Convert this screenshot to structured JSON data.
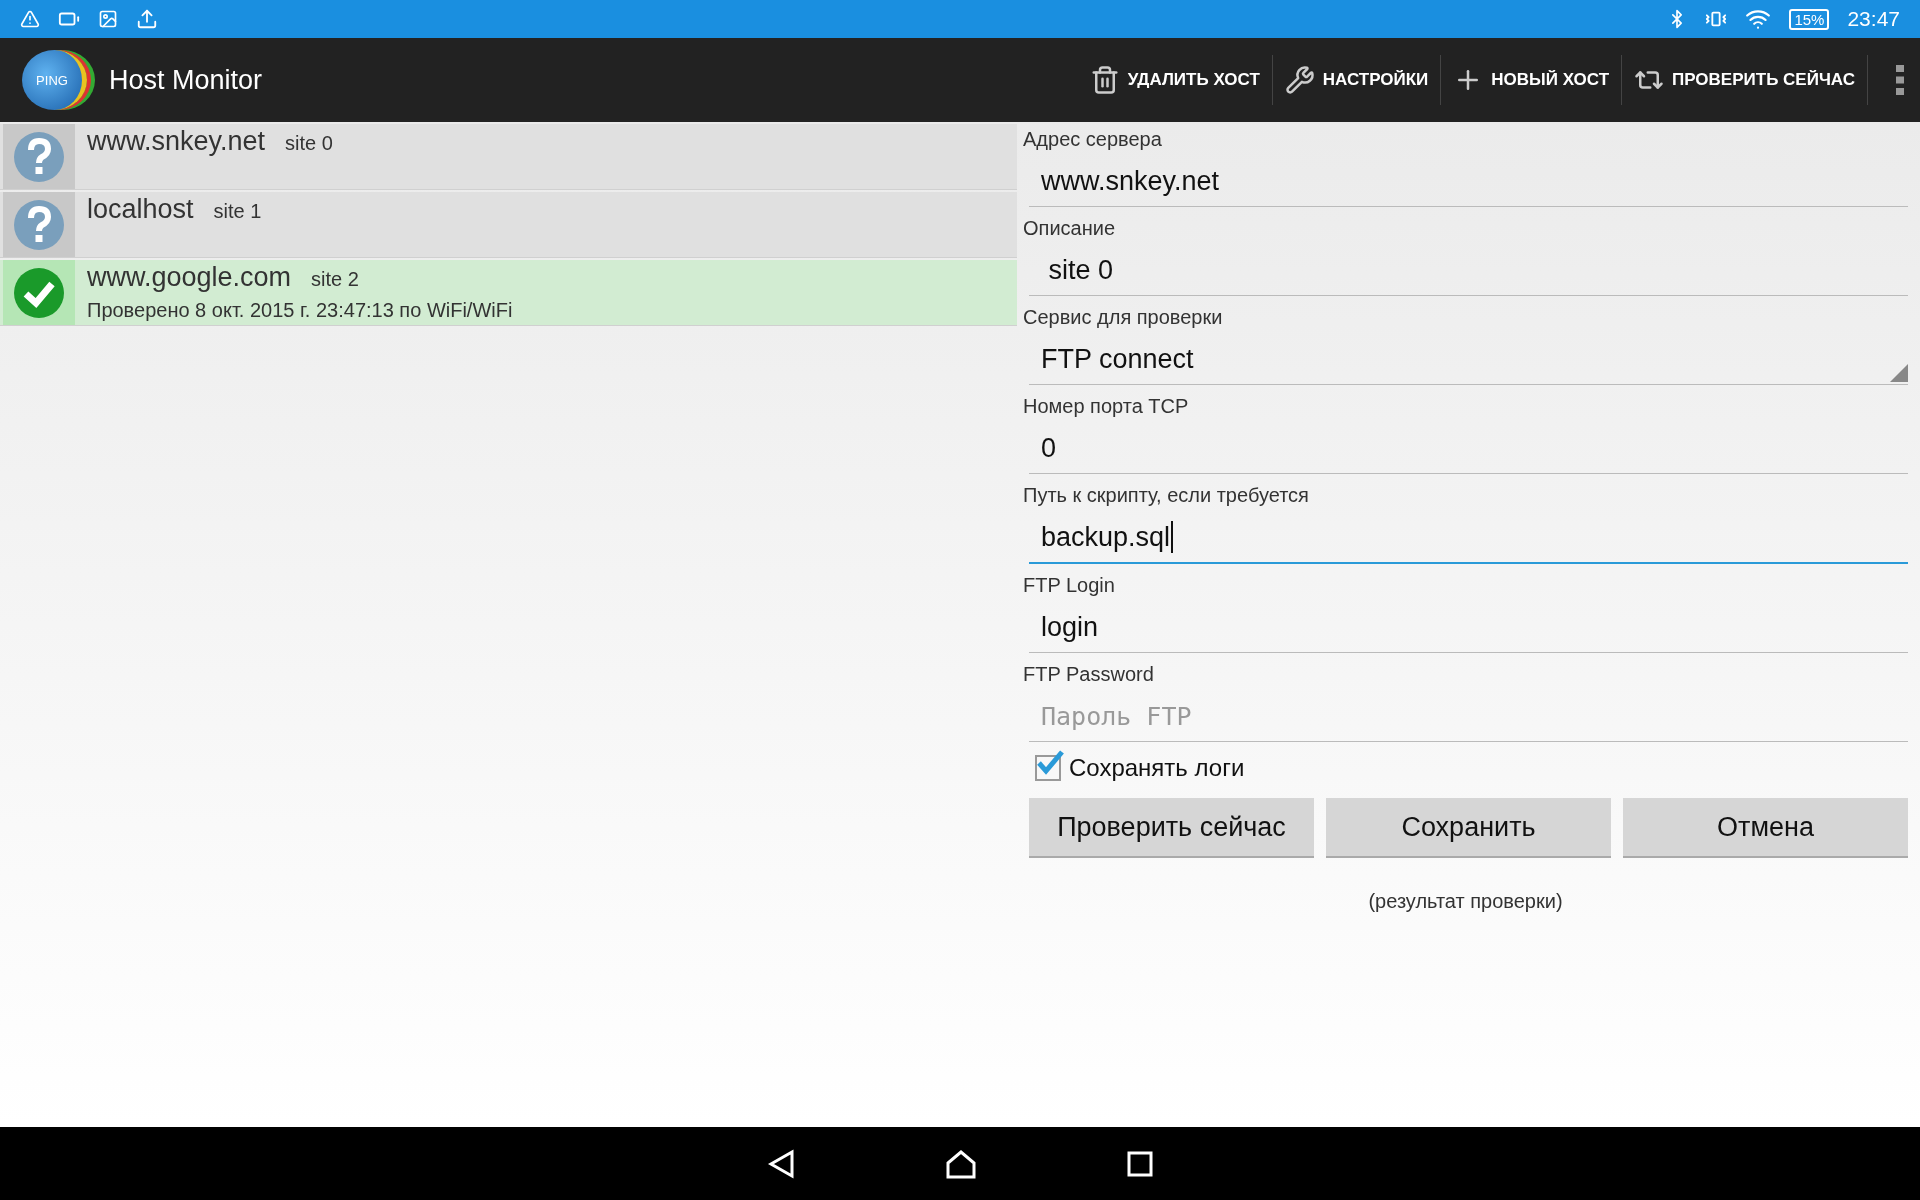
{
  "status_bar": {
    "battery": "15%",
    "time": "23:47"
  },
  "action_bar": {
    "logo_text": "PING",
    "title": "Host Monitor",
    "actions": [
      {
        "kind": "delete",
        "label": "УДАЛИТЬ ХОСТ"
      },
      {
        "kind": "settings",
        "label": "НАСТРОЙКИ"
      },
      {
        "kind": "add",
        "label": "НОВЫЙ ХОСТ"
      },
      {
        "kind": "check",
        "label": "ПРОВЕРИТЬ СЕЙЧАС"
      }
    ]
  },
  "hosts": [
    {
      "name": "www.snkey.net",
      "description": "site 0",
      "kind": "unknown"
    },
    {
      "name": "localhost",
      "description": "site 1",
      "kind": "unknown"
    },
    {
      "name": "www.google.com",
      "description": "site 2",
      "kind": "ok",
      "detail": "Проверено 8 окт. 2015 г. 23:47:13 по WiFi/WiFi"
    }
  ],
  "form": {
    "fields": [
      {
        "kind": "text",
        "label": "Адрес сервера",
        "value": "www.snkey.net",
        "focused": false
      },
      {
        "kind": "text",
        "label": "Описание",
        "value": " site 0",
        "focused": false
      },
      {
        "kind": "select",
        "label": "Сервис для проверки",
        "value": "FTP connect",
        "focused": false
      },
      {
        "kind": "text",
        "label": "Номер порта TCP",
        "value": "0",
        "focused": false
      },
      {
        "kind": "text",
        "label": "Путь к скрипту, если требуется",
        "value": "backup.sql",
        "focused": true
      },
      {
        "kind": "text",
        "label": "FTP Login",
        "value": "login",
        "focused": false
      },
      {
        "kind": "password",
        "label": "FTP Password",
        "placeholder": "Пароль FTP",
        "focused": false
      }
    ],
    "save_logs": {
      "label": "Сохранять логи",
      "checked": true
    },
    "buttons": [
      "Проверить сейчас",
      "Сохранить",
      "Отмена"
    ],
    "result": "(результат проверки)"
  }
}
